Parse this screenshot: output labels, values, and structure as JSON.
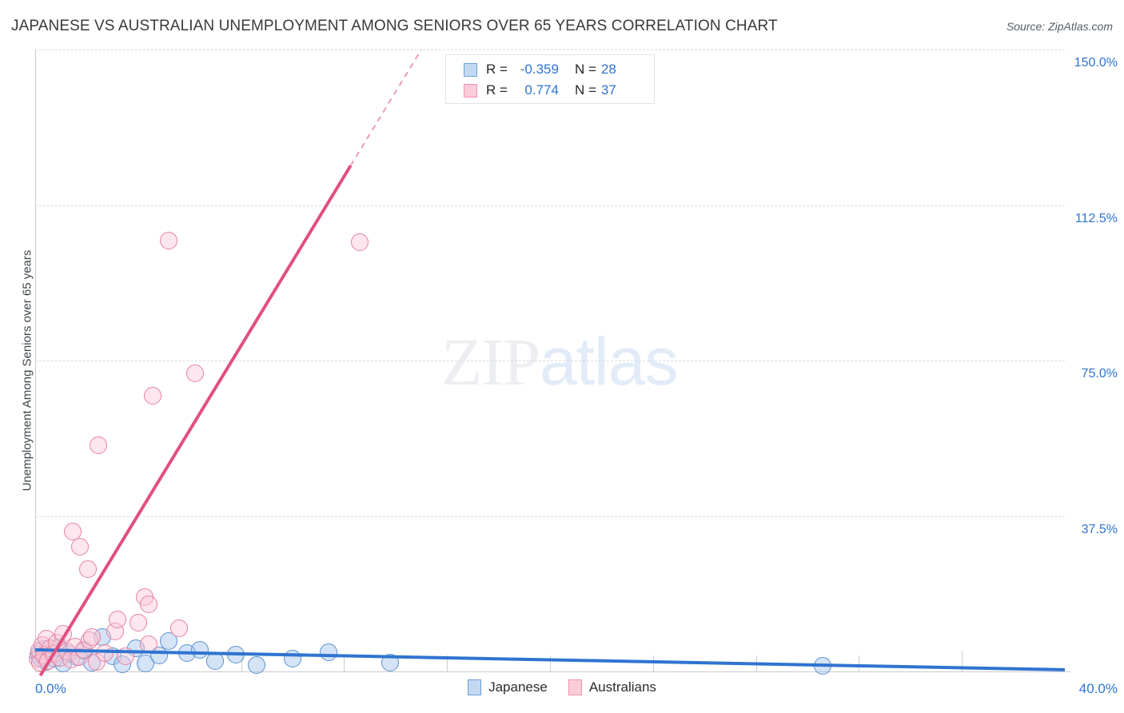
{
  "header": {
    "title": "JAPANESE VS AUSTRALIAN UNEMPLOYMENT AMONG SENIORS OVER 65 YEARS CORRELATION CHART",
    "source": "Source: ZipAtlas.com"
  },
  "watermark": {
    "part1": "ZIP",
    "part2": "atlas"
  },
  "stats": {
    "rows": [
      {
        "series": "Japanese",
        "r_label": "R =",
        "r_value": "-0.359",
        "n_label": "N =",
        "n_value": "28",
        "color": "#c3d9f2"
      },
      {
        "series": "Australians",
        "r_label": "R =",
        "r_value": "0.774",
        "n_label": "N =",
        "n_value": "37",
        "color": "#fbccd9"
      }
    ]
  },
  "legend": {
    "items": [
      {
        "label": "Japanese",
        "color": "#c3d9f2"
      },
      {
        "label": "Australians",
        "color": "#fbccd9"
      }
    ]
  },
  "chart_data": {
    "type": "scatter",
    "title": "JAPANESE VS AUSTRALIAN UNEMPLOYMENT AMONG SENIORS OVER 65 YEARS CORRELATION CHART",
    "xlabel": "",
    "ylabel": "Unemployment Among Seniors over 65 years",
    "xlim": [
      0.0,
      40.0
    ],
    "ylim": [
      0.0,
      150.0
    ],
    "x_ticklabels": [
      "0.0%",
      "40.0%"
    ],
    "y_ticklabels": [
      "150.0%",
      "112.5%",
      "75.0%",
      "37.5%"
    ],
    "y_ticks": [
      150.0,
      112.5,
      75.0,
      37.5
    ],
    "grid": true,
    "legend_position": "bottom-center",
    "accent_blue": "#2f74d0",
    "accent_pink": "#e0507f",
    "series": [
      {
        "name": "Japanese",
        "color": "#a0c4eb",
        "edge": "#5b91cf",
        "r": -0.359,
        "n": 28,
        "trend": {
          "x0": 0.0,
          "y0": 5.2,
          "x1": 40.0,
          "y1": 0.4,
          "style": "solid"
        },
        "points": [
          {
            "x": 0.12,
            "y": 4.0
          },
          {
            "x": 0.2,
            "y": 3.2
          },
          {
            "x": 0.3,
            "y": 5.4
          },
          {
            "x": 0.45,
            "y": 2.4
          },
          {
            "x": 0.6,
            "y": 4.6
          },
          {
            "x": 0.75,
            "y": 3.0
          },
          {
            "x": 0.9,
            "y": 5.8
          },
          {
            "x": 1.1,
            "y": 2.0
          },
          {
            "x": 1.3,
            "y": 4.2
          },
          {
            "x": 1.6,
            "y": 3.4
          },
          {
            "x": 1.9,
            "y": 5.0
          },
          {
            "x": 2.2,
            "y": 2.2
          },
          {
            "x": 2.6,
            "y": 8.2
          },
          {
            "x": 3.0,
            "y": 3.6
          },
          {
            "x": 3.4,
            "y": 1.8
          },
          {
            "x": 3.9,
            "y": 5.6
          },
          {
            "x": 4.3,
            "y": 2.0
          },
          {
            "x": 4.8,
            "y": 3.8
          },
          {
            "x": 5.2,
            "y": 7.4
          },
          {
            "x": 5.9,
            "y": 4.4
          },
          {
            "x": 6.4,
            "y": 5.2
          },
          {
            "x": 7.0,
            "y": 2.6
          },
          {
            "x": 7.8,
            "y": 4.0
          },
          {
            "x": 8.6,
            "y": 1.6
          },
          {
            "x": 10.0,
            "y": 3.0
          },
          {
            "x": 11.4,
            "y": 4.6
          },
          {
            "x": 13.8,
            "y": 2.2
          },
          {
            "x": 30.6,
            "y": 1.4
          }
        ]
      },
      {
        "name": "Australians",
        "color": "#fac8d6",
        "edge": "#e8809f",
        "r": 0.774,
        "n": 37,
        "trend": {
          "x0": 0.2,
          "y0": -1.0,
          "x1": 15.0,
          "y1": 150.0,
          "style": "solid-then-dashed",
          "dash_from_y": 122.0
        },
        "points": [
          {
            "x": 0.1,
            "y": 3.0
          },
          {
            "x": 0.15,
            "y": 5.0
          },
          {
            "x": 0.2,
            "y": 2.2
          },
          {
            "x": 0.28,
            "y": 6.4
          },
          {
            "x": 0.35,
            "y": 3.8
          },
          {
            "x": 0.42,
            "y": 8.0
          },
          {
            "x": 0.5,
            "y": 2.6
          },
          {
            "x": 0.6,
            "y": 5.6
          },
          {
            "x": 0.7,
            "y": 4.2
          },
          {
            "x": 0.85,
            "y": 7.0
          },
          {
            "x": 0.95,
            "y": 3.2
          },
          {
            "x": 1.1,
            "y": 9.0
          },
          {
            "x": 1.25,
            "y": 4.8
          },
          {
            "x": 1.4,
            "y": 2.8
          },
          {
            "x": 1.55,
            "y": 6.0
          },
          {
            "x": 1.7,
            "y": 3.4
          },
          {
            "x": 1.9,
            "y": 5.2
          },
          {
            "x": 2.1,
            "y": 7.6
          },
          {
            "x": 2.4,
            "y": 2.4
          },
          {
            "x": 2.7,
            "y": 4.4
          },
          {
            "x": 3.1,
            "y": 9.6
          },
          {
            "x": 3.5,
            "y": 3.6
          },
          {
            "x": 4.0,
            "y": 11.8
          },
          {
            "x": 4.4,
            "y": 6.6
          },
          {
            "x": 1.45,
            "y": 33.8
          },
          {
            "x": 1.75,
            "y": 30.0
          },
          {
            "x": 2.05,
            "y": 24.6
          },
          {
            "x": 2.2,
            "y": 8.2
          },
          {
            "x": 4.25,
            "y": 18.0
          },
          {
            "x": 4.4,
            "y": 16.2
          },
          {
            "x": 5.6,
            "y": 10.4
          },
          {
            "x": 2.45,
            "y": 54.6
          },
          {
            "x": 4.55,
            "y": 66.6
          },
          {
            "x": 6.2,
            "y": 72.0
          },
          {
            "x": 5.2,
            "y": 104.0
          },
          {
            "x": 12.6,
            "y": 103.6
          },
          {
            "x": 3.2,
            "y": 12.6
          }
        ]
      }
    ]
  }
}
